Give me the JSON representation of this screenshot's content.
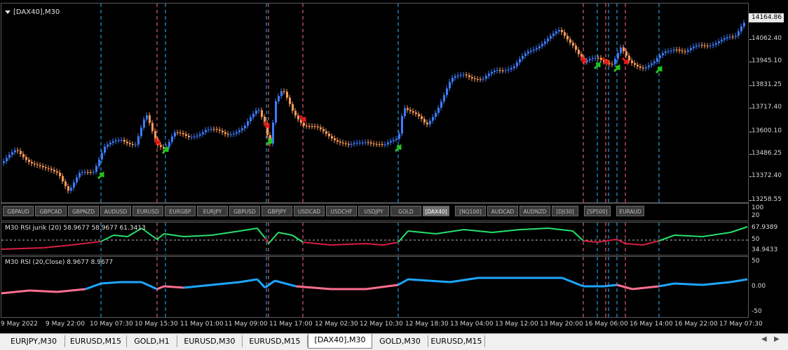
{
  "chart": {
    "title": "[DAX40],M30",
    "current_price": "14164.86",
    "price_scale": [
      "14062.40",
      "13945.10",
      "13831.25",
      "13717.40",
      "13600.10",
      "13486.25",
      "13372.40",
      "13258.55"
    ],
    "buttons": [
      "GBPAUD",
      "GBPCAD",
      "GBPNZD",
      "AUDUSD",
      "EURUSD",
      "EURGBP",
      "EURJPY",
      "GBPUSD",
      "GBPJPY",
      "USDCAD",
      "USDCHF",
      "USDJPY",
      "GOLD",
      "[DAX40]",
      "[NQ100]",
      "AUDCAD",
      "AUDNZD",
      "[DJI30]",
      "[SP500]",
      "EURAUD"
    ],
    "active_button": "[DAX40]",
    "strip_scale": [
      "100",
      "20"
    ],
    "colors": {
      "bull": "#3d7bff",
      "bear": "#ff9c5a",
      "rsi_up": "#26e26b",
      "rsi_down": "#d81e42",
      "rsi2_up": "#1ea6ff",
      "rsi2_down": "#ff6f91",
      "sig_buy": "#21c41e",
      "sig_sell": "#e51919",
      "vline_buy": "#2bb6ff",
      "vline_sell": "#ff6e8a"
    }
  },
  "rsi_jurik": {
    "label": "M30  RSI jurik (20) 58.9677 58.9677 61.3413",
    "scale": [
      "67.9389",
      "50",
      "34.9433"
    ]
  },
  "rsi": {
    "label": "M30 RSI (20,Close) 8.9677 8.9677",
    "scale": [
      "50",
      "0.00",
      "-50"
    ]
  },
  "time_axis": [
    "9 May 2022",
    "9 May 22:00",
    "10 May 07:30",
    "10 May 15:30",
    "11 May 01:00",
    "11 May 09:00",
    "11 May 17:00",
    "12 May 02:30",
    "12 May 10:30",
    "12 May 18:30",
    "13 May 04:00",
    "13 May 12:00",
    "13 May 20:00",
    "16 May 06:00",
    "16 May 14:00",
    "16 May 22:00",
    "17 May 07:30"
  ],
  "tabs": [
    "EURJPY,M30",
    "EURUSD,M15",
    "GOLD,H1",
    "EURUSD,M30",
    "EURUSD,M15",
    "[DAX40],M30",
    "GOLD,M30",
    "EURUSD,M15"
  ],
  "active_tab": "[DAX40],M30"
}
